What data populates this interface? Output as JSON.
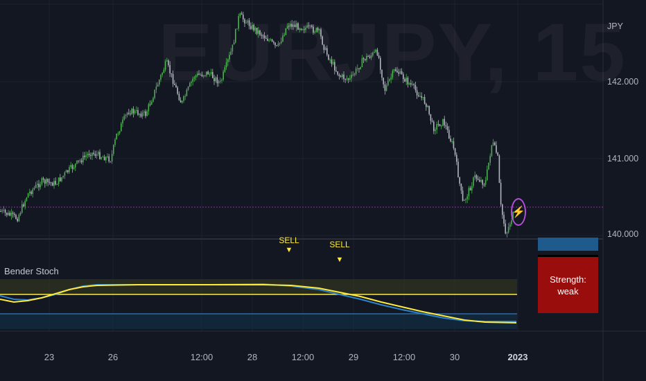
{
  "chart": {
    "symbol_watermark": "EURJPY, 15",
    "currency": "JPY",
    "y_axis_ticks": [
      "142.000",
      "141.000",
      "140.000"
    ],
    "x_axis_ticks": [
      "23",
      "26",
      "12:00",
      "28",
      "12:00",
      "29",
      "12:00",
      "30",
      "2023"
    ],
    "indicator_label": "Bender Stoch",
    "signals": [
      "SELL",
      "SELL"
    ],
    "strength_label": "Strength:",
    "strength_value": "weak",
    "colors": {
      "background": "#131722",
      "up_candle": "#4caf50",
      "down_candle": "#b2b5be",
      "price_line": "#9c27b0",
      "stoch_k": "#2962ff",
      "stoch_d": "#ffeb3b",
      "strength_box": "#990d0d"
    }
  },
  "chart_data": {
    "type": "line",
    "title": "EURJPY, 15",
    "price_series": {
      "name": "EURJPY",
      "x": [
        "23",
        "26",
        "12:00",
        "28",
        "12:00",
        "29",
        "12:00",
        "30",
        "2023"
      ],
      "values": [
        140.3,
        140.9,
        142.1,
        142.7,
        142.6,
        142.3,
        141.9,
        140.9,
        140.1
      ]
    },
    "yticks": [
      142.0,
      141.0,
      140.0
    ],
    "ylim": [
      139.95,
      142.85
    ]
  }
}
